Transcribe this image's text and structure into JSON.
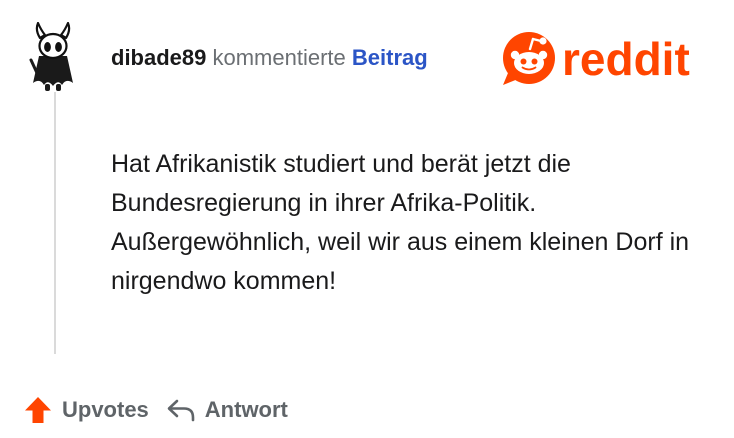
{
  "comment": {
    "username": "dibade89",
    "action_text": "kommentierte",
    "post_link_label": "Beitrag",
    "body": "Hat Afrikanistik studiert und berät jetzt die Bundesregierung in ihrer Afrika-Politik. Außergewöhnlich, weil wir aus einem kleinen Dorf in nirgendwo kommen!"
  },
  "brand": {
    "logo_text": "reddit",
    "color": "#ff4500"
  },
  "actions": {
    "upvote_label": "Upvotes",
    "reply_label": "Antwort"
  },
  "icons": {
    "avatar": "hollow-knight-avatar",
    "upvote": "upvote-arrow-icon",
    "reply": "reply-arrow-icon"
  },
  "colors": {
    "username": "#1a1a1b",
    "secondary_text": "#6b6f73",
    "link": "#2b55c6",
    "upvote": "#ff4500",
    "thread_line": "#dadada"
  }
}
